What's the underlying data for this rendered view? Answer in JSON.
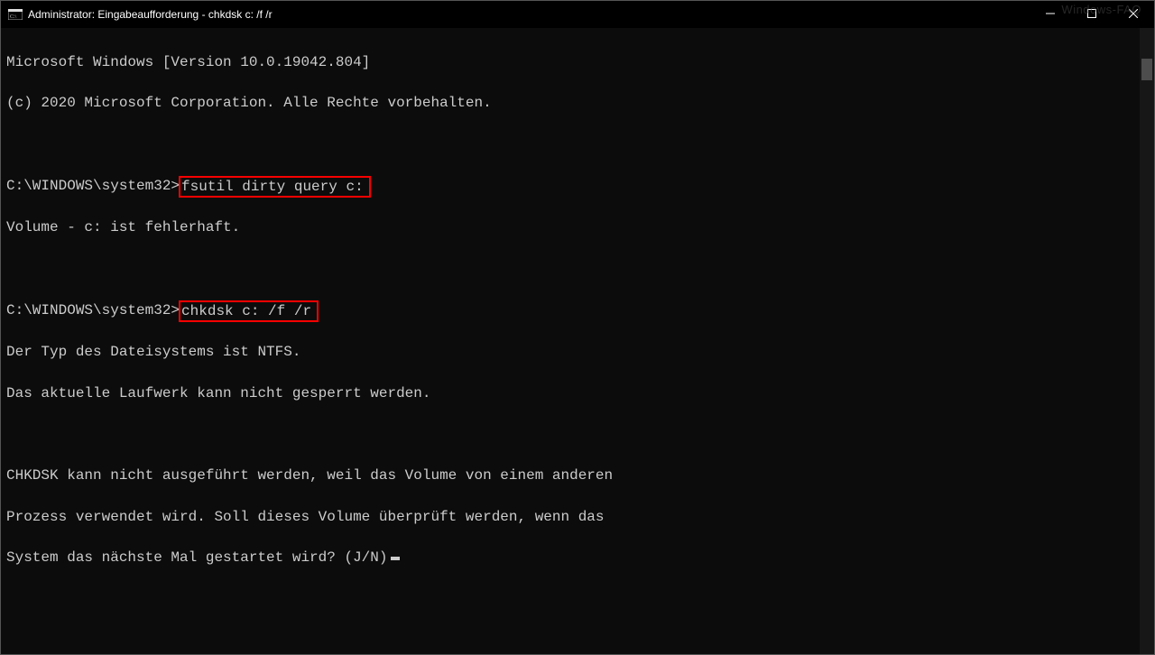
{
  "titlebar": {
    "title": "Administrator: Eingabeaufforderung - chkdsk  c: /f /r",
    "min_label": "Minimize",
    "max_label": "Maximize",
    "close_label": "Close"
  },
  "watermark": "Windows-FAQ",
  "terminal": {
    "header_line1": "Microsoft Windows [Version 10.0.19042.804]",
    "header_line2": "(c) 2020 Microsoft Corporation. Alle Rechte vorbehalten.",
    "prompt1_prefix": "C:\\WINDOWS\\system32>",
    "prompt1_cmd": "fsutil dirty query c:",
    "output1_line1": "Volume - c: ist fehlerhaft.",
    "prompt2_prefix": "C:\\WINDOWS\\system32>",
    "prompt2_cmd": "chkdsk c: /f /r",
    "output2_line1": "Der Typ des Dateisystems ist NTFS.",
    "output2_line2": "Das aktuelle Laufwerk kann nicht gesperrt werden.",
    "output3_line1": "CHKDSK kann nicht ausgeführt werden, weil das Volume von einem anderen",
    "output3_line2": "Prozess verwendet wird. Soll dieses Volume überprüft werden, wenn das",
    "output3_line3": "System das nächste Mal gestartet wird? (J/N)"
  },
  "icons": {
    "app": "cmd-icon",
    "minimize": "minimize-icon",
    "maximize": "maximize-icon",
    "close": "close-icon"
  }
}
